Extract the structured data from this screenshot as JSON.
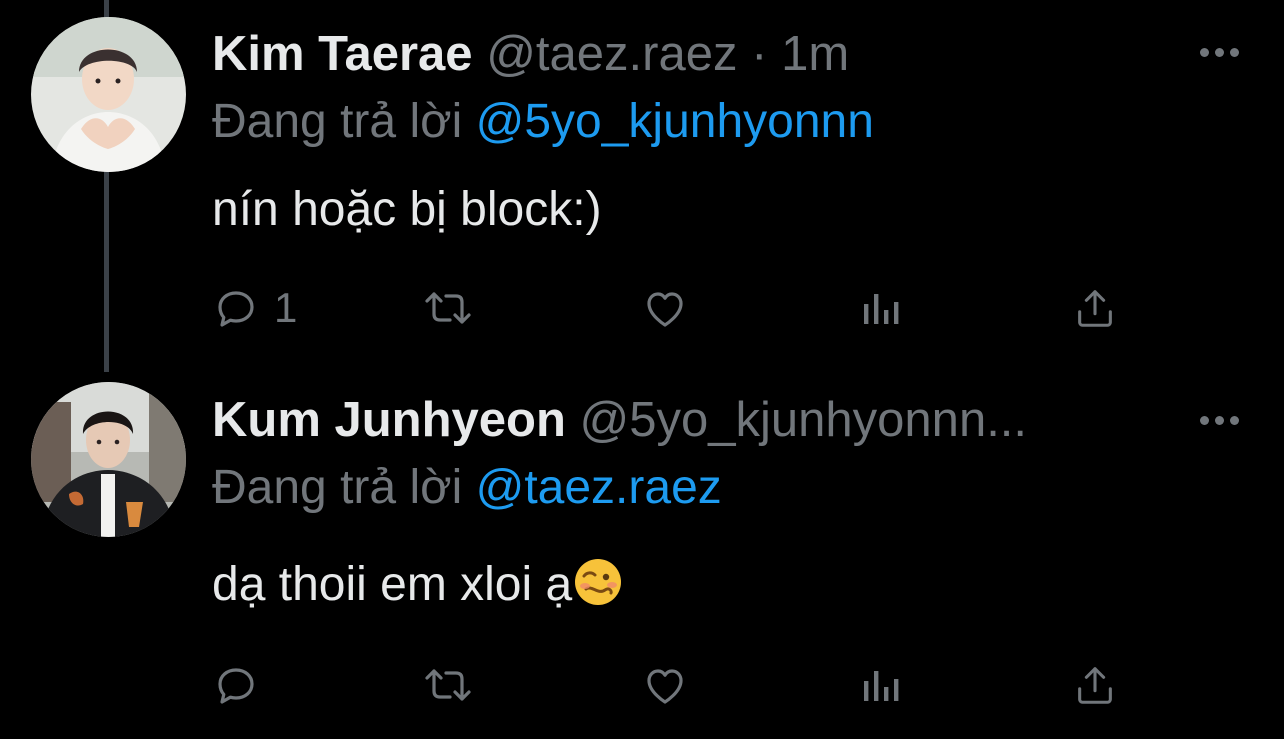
{
  "tweets": [
    {
      "author_name": "Kim Taerae",
      "handle": "@taez.raez",
      "separator": "·",
      "time": "1m",
      "replying_label": "Đang trả lời",
      "replying_to": "@5yo_kjunhyonnn",
      "text": "nín hoặc bị block:)",
      "reply_count": "1",
      "avatar_icon": "avatar-kim-taerae"
    },
    {
      "author_name": "Kum Junhyeon",
      "handle": "@5yo_kjunhyonnn...",
      "replying_label": "Đang trả lời",
      "replying_to": "@taez.raez",
      "text": "dạ thoii em xloi ạ",
      "text_emoji": "woozy-face-icon",
      "reply_count": "",
      "avatar_icon": "avatar-kum-junhyeon"
    }
  ],
  "colors": {
    "background": "#000000",
    "primary_text": "#e7e9ea",
    "secondary_text": "#71767b",
    "link": "#1d9bf0",
    "thread_line": "#3b4148"
  },
  "action_icons": [
    "reply-icon",
    "retweet-icon",
    "like-icon",
    "views-icon",
    "share-icon"
  ]
}
